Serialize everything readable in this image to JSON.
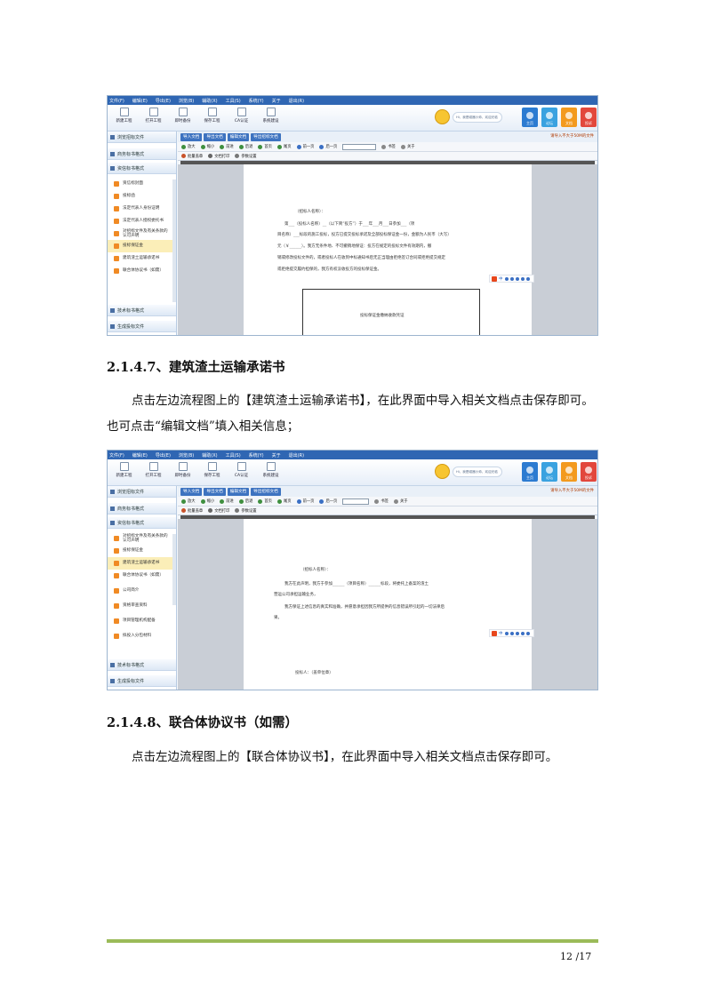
{
  "screenshot1": {
    "menu": [
      "文件(F)",
      "编辑(E)",
      "导出(E)",
      "浏览(B)",
      "辅助(X)",
      "工具(S)",
      "系统(Y)",
      "关于",
      "退出(R)"
    ],
    "tools": [
      "新建工程",
      "打开工程",
      "即时备份",
      "保存工程",
      "CA认证",
      "系统建设"
    ],
    "bubble": "Hi，我是磁器小帅，欢迎光临",
    "quick_buttons": [
      "主页",
      "论坛",
      "文档",
      "投诉"
    ],
    "top_buttons": [
      "导入文档",
      "导出文档",
      "编辑文档",
      "导出招标文档"
    ],
    "notice": "请导入不大于50M的文件",
    "word_toolbar": [
      "放大",
      "缩小",
      "前进",
      "后退",
      "首页",
      "尾页",
      "前一页",
      "后一页",
      "书签",
      "关于"
    ],
    "word_toolbar2": [
      "批量盖章",
      "文档打印",
      "参数设置"
    ],
    "sidebar_sections_top": [
      "浏览招标文件",
      "商务标书格式",
      "资信标书格式"
    ],
    "sidebar_items": [
      "资信标封面",
      "投标函",
      "法定代表人身份证明",
      "法定代表人授权委托书",
      "对招标文件及有关条款的认可声明",
      "投标保证金",
      "建筑渣土运输承诺书",
      "联合体协议书（如需）"
    ],
    "sidebar_sections_bottom": [
      "技术标书格式",
      "生成投标文件"
    ],
    "doc_lines": [
      "（招标人名称）：",
      "第___（投标人名称）__（以下简“投方”）于___年___月___日参加___（项",
      "目名称）___标段的施工投标，投方已提交投标承诺及全部投标保证金一份，金额为人民币（大写）",
      "元（￥______）。我方无条件地、不可撤销地保证：投方在规定的投标文件有效期内，撤",
      "销或修改投标文件的，或者投标人在收到中标通知书后无正当理由拒绝签订合同或拒绝提交规定",
      "或拒绝提交履约担保的，我方有权没收投方的投标保证金。"
    ],
    "inner_box_caption": "投标保证金缴纳收款凭证"
  },
  "heading1": "2.1.4.7、建筑渣土运输承诺书",
  "para1": "点击左边流程图上的【建筑渣土运输承诺书】，在此界面中导入相关文档点击保存即可。也可点击“编辑文档”填入相关信息；",
  "screenshot2": {
    "sidebar_sections_top": [
      "浏览招标文件",
      "商务标书格式",
      "资信标书格式"
    ],
    "sidebar_items": [
      "对招标文件及有关条款的认可声明",
      "投标保证金",
      "建筑渣土运输承诺书",
      "联合体协议书（如需）",
      "公司简介",
      "资格审查资料",
      "项目管理机构配备",
      "拟投入分包材料"
    ],
    "sidebar_sections_bottom": [
      "技术标书格式",
      "生成投标文件"
    ],
    "doc_lines": [
      "（招标人名称）：",
      "我方在此声明，我方于参加______（项目名称）______标段，将委托上备案的渣土",
      "营运公司承担运输业务，",
      "我方保证上述信息的真实和准确，并愿意承担因我方所提供的信息错误所引起的一切法律后",
      "果。"
    ],
    "sign_label": "投标人：（盖单位章）"
  },
  "heading2": "2.1.4.8、联合体协议书（如需）",
  "para2": "点击左边流程图上的【联合体协议书】，在此界面中导入相关文档点击保存即可。",
  "page_number": "12 /17",
  "colors": {
    "accent": "#2f66b3",
    "footer_line": "#9bbb59",
    "orange": "#f08a24"
  }
}
